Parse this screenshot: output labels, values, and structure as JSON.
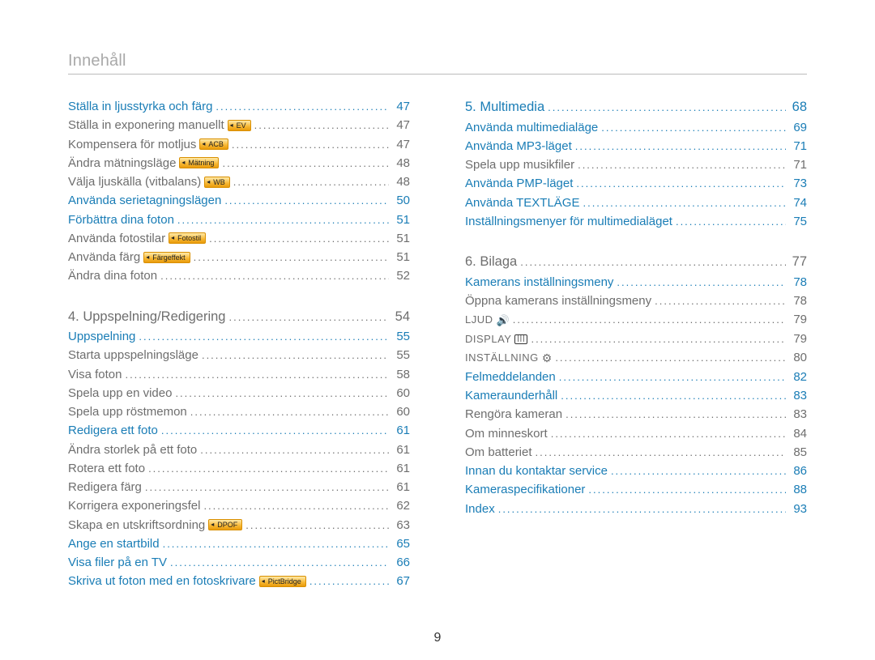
{
  "header": {
    "title": "Innehåll"
  },
  "page_number": "9",
  "left": [
    {
      "label": "Ställa in ljusstyrka och färg",
      "page": "47",
      "style": "link"
    },
    {
      "label": "Ställa in exponering manuellt",
      "tag": "EV",
      "page": "47",
      "style": "plain"
    },
    {
      "label": "Kompensera för motljus",
      "tag": "ACB",
      "page": "47",
      "style": "plain"
    },
    {
      "label": "Ändra mätningsläge",
      "tag": "Mätning",
      "page": "48",
      "style": "plain"
    },
    {
      "label": "Välja ljuskälla (vitbalans)",
      "tag": "WB",
      "page": "48",
      "style": "plain"
    },
    {
      "label": "Använda serietagningslägen",
      "page": "50",
      "style": "link"
    },
    {
      "label": "Förbättra dina foton",
      "page": "51",
      "style": "link"
    },
    {
      "label": "Använda fotostilar",
      "tag": "Fotostil",
      "page": "51",
      "style": "plain"
    },
    {
      "label": "Använda färg",
      "tag": "Färgeffekt",
      "page": "51",
      "style": "plain"
    },
    {
      "label": "Ändra dina foton",
      "page": "52",
      "style": "plain"
    },
    {
      "label": "4. Uppspelning/Redigering",
      "page": "54",
      "style": "plain",
      "chapter": true
    },
    {
      "label": "Uppspelning",
      "page": "55",
      "style": "link"
    },
    {
      "label": "Starta uppspelningsläge",
      "page": "55",
      "style": "plain"
    },
    {
      "label": "Visa foton",
      "page": "58",
      "style": "plain"
    },
    {
      "label": "Spela upp en video",
      "page": "60",
      "style": "plain"
    },
    {
      "label": "Spela upp röstmemon",
      "page": "60",
      "style": "plain"
    },
    {
      "label": "Redigera ett foto",
      "page": "61",
      "style": "link"
    },
    {
      "label": "Ändra storlek på ett foto",
      "page": "61",
      "style": "plain"
    },
    {
      "label": "Rotera ett foto",
      "page": "61",
      "style": "plain"
    },
    {
      "label": "Redigera färg",
      "page": "61",
      "style": "plain"
    },
    {
      "label": "Korrigera exponeringsfel",
      "page": "62",
      "style": "plain"
    },
    {
      "label": "Skapa en utskriftsordning",
      "tag": "DPOF",
      "page": "63",
      "style": "plain"
    },
    {
      "label": "Ange en startbild",
      "page": "65",
      "style": "link"
    },
    {
      "label": "Visa filer på en TV",
      "page": "66",
      "style": "link"
    },
    {
      "label": "Skriva ut foton med en fotoskrivare",
      "tag": "PictBridge",
      "page": "67",
      "style": "link"
    }
  ],
  "right": [
    {
      "label": "5. Multimedia",
      "page": "68",
      "style": "link",
      "chapter": true,
      "firstchapter": true
    },
    {
      "label": "Använda multimedialäge",
      "page": "69",
      "style": "link"
    },
    {
      "label": "Använda MP3-läget",
      "page": "71",
      "style": "link"
    },
    {
      "label": "Spela upp musikfiler",
      "page": "71",
      "style": "plain"
    },
    {
      "label": "Använda PMP-läget",
      "page": "73",
      "style": "link"
    },
    {
      "label": "Använda TEXTLÄGE",
      "page": "74",
      "style": "link"
    },
    {
      "label": "Inställningsmenyer för multimedialäget",
      "page": "75",
      "style": "link"
    },
    {
      "label": "6. Bilaga",
      "page": "77",
      "style": "plain",
      "chapter": true
    },
    {
      "label": "Kamerans inställningsmeny",
      "page": "78",
      "style": "link"
    },
    {
      "label": "Öppna kamerans inställningsmeny",
      "page": "78",
      "style": "plain"
    },
    {
      "label": "LJUD",
      "icon": "sound",
      "page": "79",
      "style": "plain",
      "caps": true
    },
    {
      "label": "DISPLAY",
      "icon": "display",
      "page": "79",
      "style": "plain",
      "caps": true
    },
    {
      "label": "INSTÄLLNING",
      "icon": "gear",
      "page": "80",
      "style": "plain",
      "caps": true
    },
    {
      "label": "Felmeddelanden",
      "page": "82",
      "style": "link"
    },
    {
      "label": "Kameraunderhåll",
      "page": "83",
      "style": "link"
    },
    {
      "label": "Rengöra kameran",
      "page": "83",
      "style": "plain"
    },
    {
      "label": "Om minneskort",
      "page": "84",
      "style": "plain"
    },
    {
      "label": "Om batteriet",
      "page": "85",
      "style": "plain"
    },
    {
      "label": "Innan du kontaktar service",
      "page": "86",
      "style": "link"
    },
    {
      "label": "Kameraspecifikationer",
      "page": "88",
      "style": "link"
    },
    {
      "label": "Index",
      "page": "93",
      "style": "link"
    }
  ]
}
